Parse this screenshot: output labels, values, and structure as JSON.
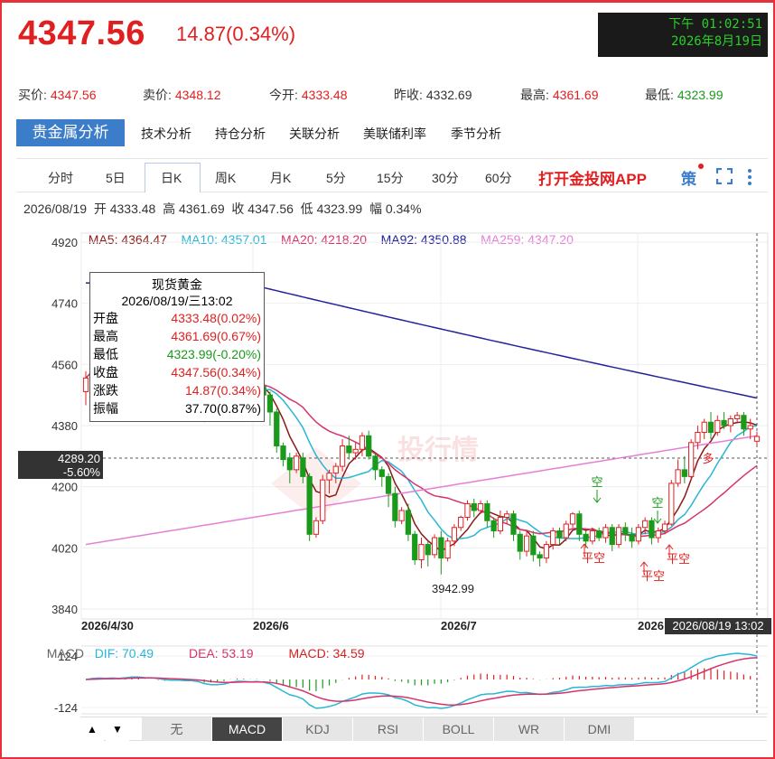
{
  "header": {
    "price": "4347.56",
    "change": "14.87(0.34%)",
    "clock_time": "下午 01:02:51",
    "clock_date": "2026年8月19日"
  },
  "quotes": [
    {
      "label": "买价:",
      "value": "4347.56",
      "color": "#e02020"
    },
    {
      "label": "卖价:",
      "value": "4348.12",
      "color": "#e02020"
    },
    {
      "label": "今开:",
      "value": "4333.48",
      "color": "#e02020"
    },
    {
      "label": "昨收:",
      "value": "4332.69",
      "color": "#333333"
    },
    {
      "label": "最高:",
      "value": "4361.69",
      "color": "#e02020"
    },
    {
      "label": "最低:",
      "value": "4323.99",
      "color": "#1a9a1a"
    }
  ],
  "nav": {
    "active": "贵金属分析",
    "items": [
      "技术分析",
      "持仓分析",
      "关联分析",
      "美联储利率",
      "季节分析"
    ]
  },
  "periods": {
    "items": [
      "分时",
      "5日",
      "日K",
      "周K",
      "月K",
      "5分",
      "15分",
      "30分",
      "60分"
    ],
    "active_index": 2,
    "app_link": "打开金投网APP",
    "strategy": "策"
  },
  "info_line": "2026/08/19  开 4333.48  高 4361.69  收 4347.56  低 4323.99  幅 0.34%",
  "ma": [
    {
      "label": "MA5: 4364.47",
      "color": "#8b1a1a"
    },
    {
      "label": "MA10: 4357.01",
      "color": "#29b6d6"
    },
    {
      "label": "MA20: 4218.20",
      "color": "#d6336c"
    },
    {
      "label": "MA92: 4350.88",
      "color": "#22229a"
    },
    {
      "label": "MA259: 4347.20",
      "color": "#e680d6"
    }
  ],
  "tooltip": {
    "title": "现货黄金",
    "date": "2026/08/19/三13:02",
    "rows": [
      {
        "k": "开盘",
        "v": "4333.48(0.02%)",
        "color": "#e02020"
      },
      {
        "k": "最高",
        "v": "4361.69(0.67%)",
        "color": "#e02020"
      },
      {
        "k": "最低",
        "v": "4323.99(-0.20%)",
        "color": "#1a9a1a"
      },
      {
        "k": "收盘",
        "v": "4347.56(0.34%)",
        "color": "#e02020"
      },
      {
        "k": "涨跌",
        "v": "14.87(0.34%)",
        "color": "#e02020"
      },
      {
        "k": "振幅",
        "v": "37.70(0.87%)",
        "color": "#000000"
      }
    ]
  },
  "cursor": {
    "price": "4289.20",
    "pct": "-5.60%",
    "date": "2026/08/19 13:02"
  },
  "chart_data": {
    "type": "candlestick",
    "y_ticks": [
      "4920",
      "4740",
      "4560",
      "4380",
      "4200",
      "4020",
      "3840"
    ],
    "ylim": [
      3840,
      4920
    ],
    "x_labels": [
      "2026/4/30",
      "2026/6",
      "2026/7",
      "2026"
    ],
    "low_annotation": "3942.99",
    "watermark": "投行情",
    "signals": [
      {
        "text": "空",
        "kind": "sell"
      },
      {
        "text": "平空",
        "kind": "cover"
      },
      {
        "text": "空",
        "kind": "sell"
      },
      {
        "text": "平空",
        "kind": "cover"
      },
      {
        "text": "平空",
        "kind": "cover"
      },
      {
        "text": "多",
        "kind": "buy"
      }
    ],
    "candles": [
      [
        4480,
        4520,
        4440,
        4540
      ],
      [
        4530,
        4560,
        4505,
        4585
      ],
      [
        4575,
        4550,
        4535,
        4595
      ],
      [
        4550,
        4520,
        4505,
        4575
      ],
      [
        4510,
        4545,
        4495,
        4565
      ],
      [
        4545,
        4525,
        4505,
        4565
      ],
      [
        4520,
        4555,
        4505,
        4575
      ],
      [
        4550,
        4570,
        4530,
        4590
      ],
      [
        4570,
        4545,
        4530,
        4600
      ],
      [
        4545,
        4520,
        4490,
        4575
      ],
      [
        4520,
        4540,
        4500,
        4560
      ],
      [
        4540,
        4510,
        4495,
        4560
      ],
      [
        4505,
        4490,
        4460,
        4530
      ],
      [
        4490,
        4510,
        4470,
        4530
      ],
      [
        4510,
        4525,
        4490,
        4550
      ],
      [
        4525,
        4500,
        4480,
        4545
      ],
      [
        4500,
        4520,
        4480,
        4530
      ],
      [
        4520,
        4480,
        4440,
        4530
      ],
      [
        4470,
        4420,
        4390,
        4490
      ],
      [
        4420,
        4445,
        4400,
        4465
      ],
      [
        4445,
        4470,
        4430,
        4490
      ],
      [
        4465,
        4500,
        4450,
        4520
      ],
      [
        4495,
        4550,
        4485,
        4565
      ],
      [
        4550,
        4530,
        4505,
        4570
      ],
      [
        4525,
        4495,
        4480,
        4540
      ],
      [
        4500,
        4480,
        4460,
        4510
      ],
      [
        4480,
        4500,
        4440,
        4510
      ],
      [
        4495,
        4470,
        4440,
        4510
      ],
      [
        4470,
        4420,
        4380,
        4480
      ],
      [
        4420,
        4320,
        4300,
        4430
      ],
      [
        4320,
        4280,
        4260,
        4330
      ],
      [
        4285,
        4250,
        4210,
        4300
      ],
      [
        4250,
        4290,
        4240,
        4300
      ],
      [
        4285,
        4230,
        4210,
        4300
      ],
      [
        4230,
        4060,
        4040,
        4240
      ],
      [
        4060,
        4100,
        4050,
        4110
      ],
      [
        4100,
        4220,
        4090,
        4235
      ],
      [
        4220,
        4240,
        4180,
        4250
      ],
      [
        4240,
        4260,
        4210,
        4270
      ],
      [
        4260,
        4320,
        4245,
        4340
      ],
      [
        4320,
        4300,
        4280,
        4350
      ],
      [
        4300,
        4310,
        4280,
        4330
      ],
      [
        4310,
        4350,
        4290,
        4360
      ],
      [
        4350,
        4290,
        4280,
        4365
      ],
      [
        4290,
        4250,
        4220,
        4300
      ],
      [
        4250,
        4230,
        4200,
        4260
      ],
      [
        4230,
        4180,
        4140,
        4240
      ],
      [
        4180,
        4100,
        4080,
        4200
      ],
      [
        4100,
        4130,
        4090,
        4140
      ],
      [
        4130,
        4060,
        4040,
        4150
      ],
      [
        4060,
        3985,
        3970,
        4070
      ],
      [
        3985,
        4030,
        3960,
        4050
      ],
      [
        4030,
        4000,
        3965,
        4040
      ],
      [
        4000,
        4050,
        3990,
        4060
      ],
      [
        4050,
        3990,
        3942,
        4070
      ],
      [
        3990,
        4040,
        3980,
        4050
      ],
      [
        4040,
        4080,
        4025,
        4090
      ],
      [
        4080,
        4110,
        4070,
        4115
      ],
      [
        4110,
        4150,
        4100,
        4160
      ],
      [
        4150,
        4130,
        4110,
        4165
      ],
      [
        4130,
        4150,
        4120,
        4160
      ],
      [
        4150,
        4100,
        4080,
        4160
      ],
      [
        4100,
        4070,
        4050,
        4110
      ],
      [
        4070,
        4110,
        4060,
        4130
      ],
      [
        4110,
        4120,
        4090,
        4130
      ],
      [
        4120,
        4060,
        4040,
        4130
      ],
      [
        4060,
        4010,
        3985,
        4070
      ],
      [
        4010,
        4055,
        3995,
        4070
      ],
      [
        4055,
        4000,
        3980,
        4070
      ],
      [
        4000,
        3990,
        3965,
        4010
      ],
      [
        3990,
        4030,
        3975,
        4040
      ],
      [
        4030,
        4070,
        4015,
        4080
      ],
      [
        4070,
        4050,
        4030,
        4080
      ],
      [
        4050,
        4090,
        4040,
        4100
      ],
      [
        4090,
        4120,
        4080,
        4125
      ],
      [
        4120,
        4060,
        4040,
        4130
      ],
      [
        4060,
        4040,
        4020,
        4070
      ],
      [
        4040,
        4070,
        4030,
        4080
      ],
      [
        4070,
        4050,
        4040,
        4080
      ],
      [
        4050,
        4080,
        4035,
        4090
      ],
      [
        4080,
        4030,
        4010,
        4090
      ],
      [
        4030,
        4080,
        4020,
        4090
      ],
      [
        4080,
        4060,
        4040,
        4095
      ],
      [
        4060,
        4040,
        4020,
        4080
      ],
      [
        4040,
        4080,
        4030,
        4090
      ],
      [
        4080,
        4100,
        4060,
        4110
      ],
      [
        4100,
        4050,
        4030,
        4110
      ],
      [
        4050,
        4070,
        4035,
        4080
      ],
      [
        4070,
        4090,
        4060,
        4100
      ],
      [
        4090,
        4210,
        4085,
        4220
      ],
      [
        4210,
        4250,
        4200,
        4280
      ],
      [
        4250,
        4230,
        4210,
        4290
      ],
      [
        4230,
        4330,
        4220,
        4340
      ],
      [
        4330,
        4360,
        4310,
        4380
      ],
      [
        4360,
        4390,
        4340,
        4400
      ],
      [
        4390,
        4360,
        4340,
        4420
      ],
      [
        4360,
        4395,
        4350,
        4410
      ],
      [
        4395,
        4380,
        4370,
        4420
      ],
      [
        4380,
        4400,
        4360,
        4410
      ],
      [
        4400,
        4410,
        4390,
        4420
      ],
      [
        4410,
        4370,
        4350,
        4420
      ],
      [
        4370,
        4380,
        4340,
        4400
      ],
      [
        4334,
        4348,
        4324,
        4362
      ]
    ],
    "series": [
      {
        "name": "MA5",
        "color": "#8b1a1a"
      },
      {
        "name": "MA10",
        "color": "#29b6d6"
      },
      {
        "name": "MA20",
        "color": "#d6336c"
      },
      {
        "name": "MA92",
        "color": "#22229a"
      },
      {
        "name": "MA259",
        "color": "#e680d6"
      }
    ],
    "macd": {
      "dif_label": "DIF: 70.49",
      "dea_label": "DEA: 53.19",
      "macd_label": "MACD: 34.59",
      "label_color": "#666666",
      "dif_color": "#29b6d6",
      "dea_color": "#d6336c",
      "hist_color": "#e02020",
      "y_ticks": [
        "124",
        "-124"
      ]
    }
  },
  "indicators": {
    "items": [
      "无",
      "MACD",
      "KDJ",
      "RSI",
      "BOLL",
      "WR",
      "DMI"
    ],
    "active_index": 1,
    "up_arrow": "▲",
    "down_arrow": "▼"
  }
}
